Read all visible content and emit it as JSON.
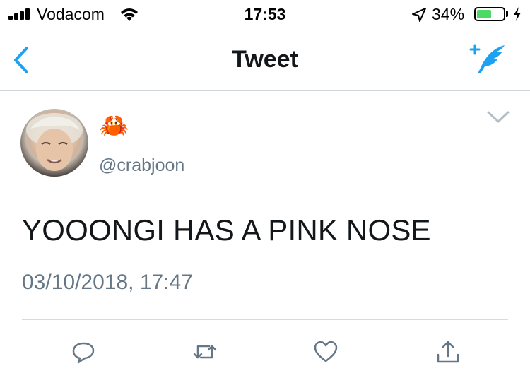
{
  "status_bar": {
    "carrier": "Vodacom",
    "time": "17:53",
    "battery_percent_label": "34%",
    "battery_level": 0.34,
    "battery_color": "#4cd964"
  },
  "nav": {
    "title": "Tweet",
    "back_icon": "chevron-left-icon",
    "compose_icon": "compose-tweet-icon",
    "accent_color": "#1da1f2"
  },
  "tweet": {
    "display_name": "🦀",
    "handle": "@crabjoon",
    "text": "YOOONGI HAS A PINK NOSE",
    "timestamp": "03/10/2018, 17:47"
  },
  "actions": [
    {
      "icon": "reply-icon"
    },
    {
      "icon": "retweet-icon"
    },
    {
      "icon": "like-icon"
    },
    {
      "icon": "share-icon"
    }
  ]
}
